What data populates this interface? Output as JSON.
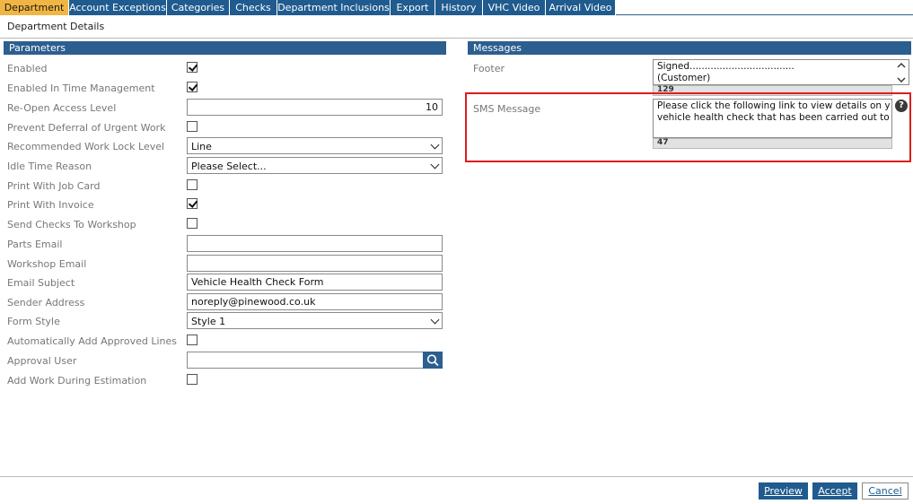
{
  "tabs": [
    {
      "label": "Department",
      "active": true
    },
    {
      "label": "Account Exceptions"
    },
    {
      "label": "Categories"
    },
    {
      "label": "Checks"
    },
    {
      "label": "Department Inclusions"
    },
    {
      "label": "Export"
    },
    {
      "label": "History"
    },
    {
      "label": "VHC Video"
    },
    {
      "label": "Arrival Video"
    }
  ],
  "page_title": "Department Details",
  "parameters": {
    "header": "Parameters",
    "enabled": {
      "label": "Enabled",
      "checked": true
    },
    "enabled_time_mgmt": {
      "label": "Enabled In Time Management",
      "checked": true
    },
    "reopen_access_level": {
      "label": "Re-Open Access Level",
      "value": "10"
    },
    "prevent_deferral": {
      "label": "Prevent Deferral of Urgent Work",
      "checked": false
    },
    "work_lock_level": {
      "label": "Recommended Work Lock Level",
      "value": "Line"
    },
    "idle_time_reason": {
      "label": "Idle Time Reason",
      "value": "Please Select..."
    },
    "print_job_card": {
      "label": "Print With Job Card",
      "checked": false
    },
    "print_invoice": {
      "label": "Print With Invoice",
      "checked": true
    },
    "send_checks_workshop": {
      "label": "Send Checks To Workshop",
      "checked": false
    },
    "parts_email": {
      "label": "Parts Email",
      "value": ""
    },
    "workshop_email": {
      "label": "Workshop Email",
      "value": ""
    },
    "email_subject": {
      "label": "Email Subject",
      "value": "Vehicle Health Check Form"
    },
    "sender_address": {
      "label": "Sender Address",
      "value": "noreply@pinewood.co.uk"
    },
    "form_style": {
      "label": "Form Style",
      "value": "Style 1"
    },
    "auto_add_approved": {
      "label": "Automatically Add Approved Lines",
      "checked": false
    },
    "approval_user": {
      "label": "Approval User",
      "value": ""
    },
    "add_work_estimation": {
      "label": "Add Work During Estimation",
      "checked": false
    }
  },
  "messages": {
    "header": "Messages",
    "footer": {
      "label": "Footer",
      "text": "Signed...................................\n(Customer)",
      "count": "129"
    },
    "sms": {
      "label": "SMS Message",
      "text": "Please click the following link to view details on your\nvehicle health check that has been carried out today: $U",
      "count": "47"
    }
  },
  "buttons": {
    "preview": "Preview",
    "accept": "Accept",
    "cancel": "Cancel"
  },
  "colors": {
    "tab": "#1f5b8e",
    "tab_active": "#f0b542",
    "highlight": "#e01b1b"
  },
  "icons": {
    "help": "question-circle-icon",
    "search": "magnifier-icon"
  }
}
